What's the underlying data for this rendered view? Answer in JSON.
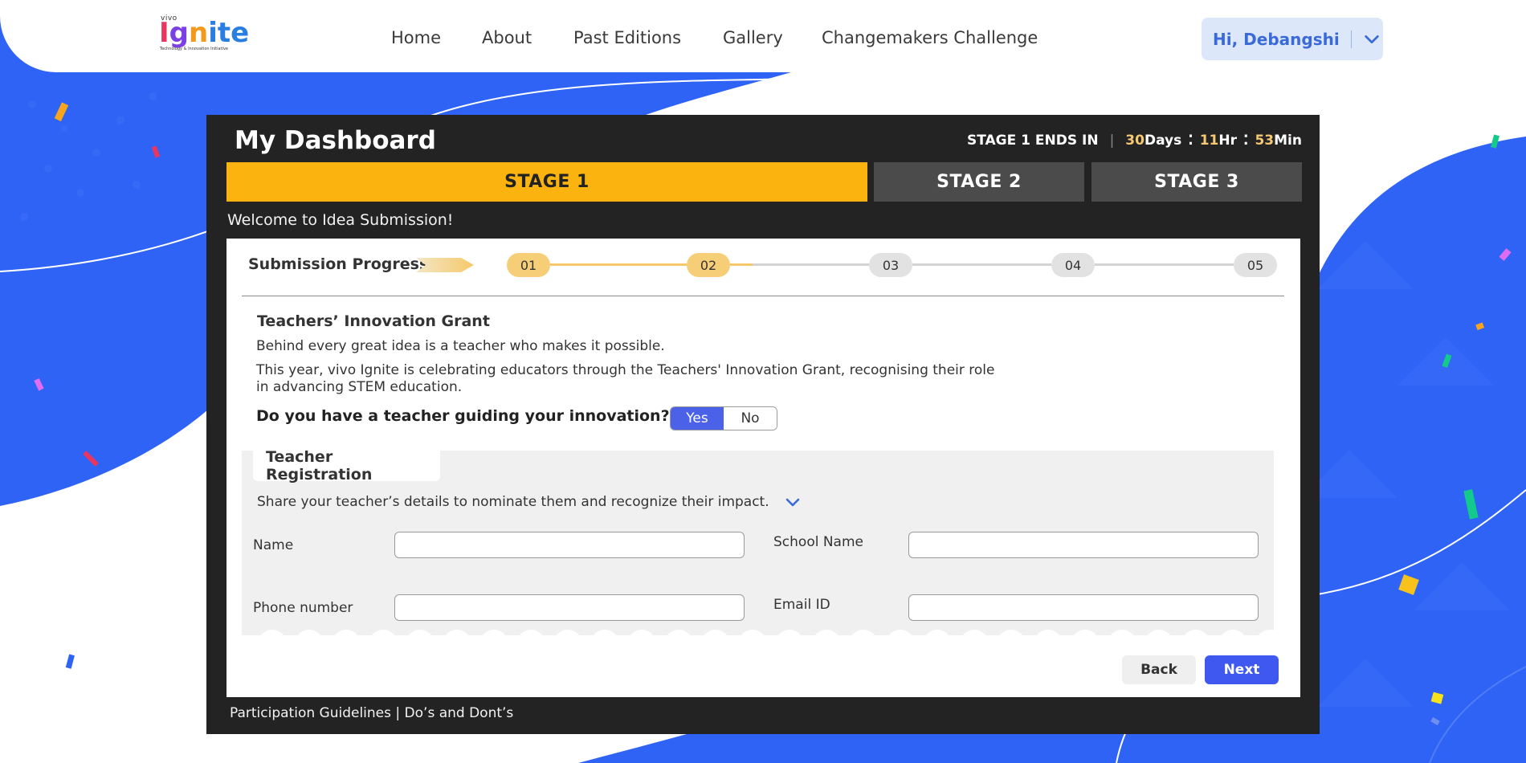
{
  "theme": {
    "accent_blue": "#2f63f5",
    "stage_active": "#fbb40f",
    "stage_inactive": "#4b4b4b",
    "panel_bg": "#232323",
    "next_button": "#3f58ef",
    "toggle_yes": "#4a61e8"
  },
  "logo": {
    "small": "vivo",
    "word_parts": [
      "I",
      "g",
      "n",
      "ite"
    ],
    "tagline": "Technology & Innovation Initiative"
  },
  "nav": {
    "items": [
      "Home",
      "About",
      "Past Editions",
      "Gallery",
      "Changemakers Challenge"
    ]
  },
  "user": {
    "greeting": "Hi, Debangshi",
    "menu_icon": "chevron-down-icon"
  },
  "dashboard": {
    "title": "My Dashboard",
    "countdown": {
      "label": "STAGE 1 ENDS IN",
      "separator": "|",
      "days_value": "30",
      "days_unit": "Days",
      "hours_value": "11",
      "hours_unit": "Hr",
      "minutes_value": "53",
      "minutes_unit": "Min"
    },
    "stages": [
      {
        "label": "STAGE 1",
        "active": true
      },
      {
        "label": "STAGE 2",
        "active": false
      },
      {
        "label": "STAGE 3",
        "active": false
      }
    ],
    "welcome": "Welcome to Idea Submission!"
  },
  "progress": {
    "label": "Submission Progress",
    "steps": [
      "01",
      "02",
      "03",
      "04",
      "05"
    ],
    "completed_steps": 2
  },
  "grant": {
    "title": "Teachers’ Innovation Grant",
    "p1": "Behind every great idea is a teacher who makes it possible.",
    "p2": "This year, vivo Ignite is celebrating educators through the Teachers' Innovation Grant, recognising their role in advancing STEM education.",
    "question": "Do you have a teacher guiding your innovation?",
    "yes": "Yes",
    "no": "No",
    "selected": "Yes"
  },
  "registration": {
    "tab": "Teacher Registration",
    "description": "Share your teacher’s details to nominate them and recognize their impact.",
    "fields": {
      "name_label": "Name",
      "name_value": "",
      "school_label": "School Name",
      "school_value": "",
      "phone_label": "Phone number",
      "phone_value": "",
      "email_label": "Email ID",
      "email_value": ""
    }
  },
  "actions": {
    "back": "Back",
    "next": "Next"
  },
  "footer": {
    "guidelines": "Participation Guidelines",
    "separator": " | ",
    "dos": "Do’s and Dont’s"
  }
}
